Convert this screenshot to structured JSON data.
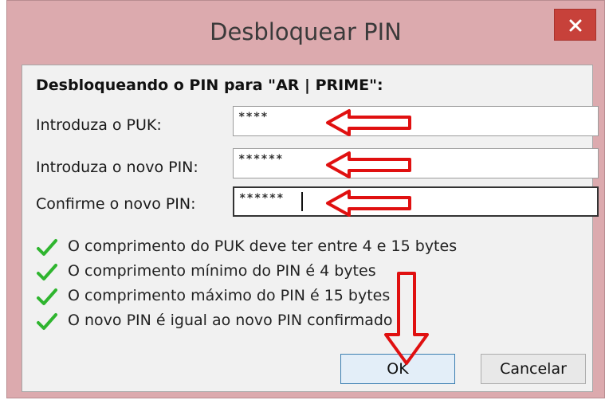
{
  "window": {
    "title": "Desbloquear PIN",
    "close_icon": "close-icon"
  },
  "dialog": {
    "heading": "Desbloqueando o PIN para \"AR | PRIME\":",
    "fields": [
      {
        "label": "Introduza o PUK:",
        "value": "****"
      },
      {
        "label": "Introduza o novo PIN:",
        "value": "******"
      },
      {
        "label": "Confirme o novo PIN:",
        "value": "******"
      }
    ],
    "rules": [
      {
        "text": "O comprimento do PUK deve ter entre 4 e 15 bytes",
        "icon": "checkmark-icon"
      },
      {
        "text": "O comprimento mínimo do PIN é 4 bytes",
        "icon": "checkmark-icon"
      },
      {
        "text": "O comprimento máximo do PIN é 15 bytes",
        "icon": "checkmark-icon"
      },
      {
        "text": "O novo PIN é igual ao novo PIN confirmado",
        "icon": "checkmark-icon"
      }
    ],
    "ok_label": "OK",
    "cancel_label": "Cancelar"
  },
  "annotations": {
    "arrow_color": "#e01010",
    "arrow_icon": "red-arrow-annotation"
  },
  "colors": {
    "titlebar": "#dcaaae",
    "close_button": "#c7413a",
    "check": "#2fb52f"
  }
}
